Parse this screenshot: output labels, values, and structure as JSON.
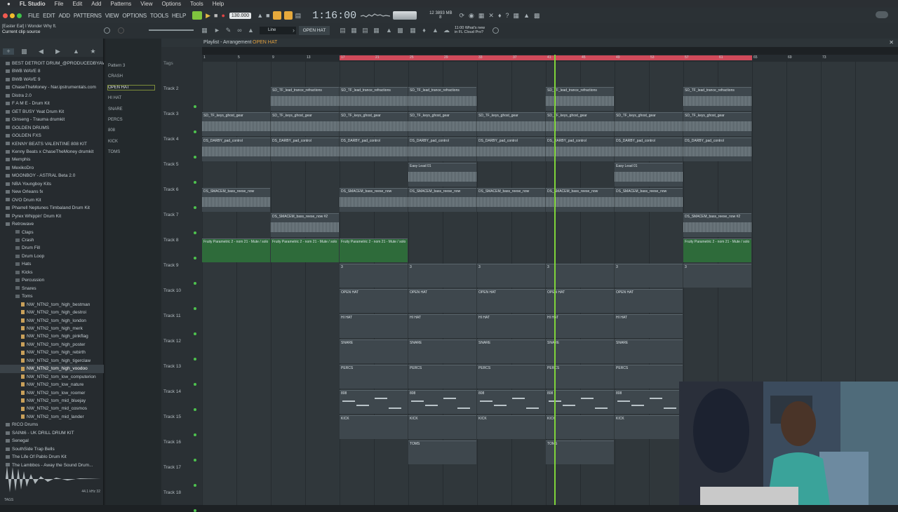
{
  "menubar": {
    "app": "FL Studio",
    "items": [
      "File",
      "Edit",
      "Add",
      "Patterns",
      "View",
      "Options",
      "Tools",
      "Help"
    ]
  },
  "toolbar": {
    "menu": [
      "FILE",
      "EDIT",
      "ADD",
      "PATTERNS",
      "VIEW",
      "OPTIONS",
      "TOOLS",
      "HELP"
    ],
    "tempo": "130.000",
    "time": "1:16:00",
    "pattern_label": "OPEN HAT",
    "cpu": "12",
    "memory": "3893 MB",
    "mem_voices": "8",
    "snap": "Line",
    "news_line1": "11:00 What's new",
    "news_line2": "in FL Cloud Pro?"
  },
  "hint": {
    "line1": "[Easter Eat] I Wonder Why ft.",
    "line2": "Current clip source"
  },
  "playlist": {
    "title": "Playlist - Arrangement",
    "pattern": "OPEN HAT",
    "tags_label": "Tags"
  },
  "browser": {
    "items": [
      {
        "label": "BEST DETROIT DRUM_@PRODUCEDBYAVEN",
        "type": "folder"
      },
      {
        "label": "BWB WAVE 8",
        "type": "folder"
      },
      {
        "label": "BWB WAVE 9",
        "type": "folder"
      },
      {
        "label": "ChaseTheMoney - Nar.ipstrumentals.com",
        "type": "folder"
      },
      {
        "label": "Distra 2.0",
        "type": "folder"
      },
      {
        "label": "F A M E - Drum Kit",
        "type": "folder"
      },
      {
        "label": "GET BUSY Yeat Drum Kit",
        "type": "folder"
      },
      {
        "label": "Ginseng - Trauma drumkit",
        "type": "folder"
      },
      {
        "label": "GOLDEN DRUMS",
        "type": "folder"
      },
      {
        "label": "GOLDEN FXS",
        "type": "folder"
      },
      {
        "label": "KENNY BEATS VALENTINE 808 KIT",
        "type": "folder"
      },
      {
        "label": "Kenny Beats x ChaseTheMoney drumkit",
        "type": "folder"
      },
      {
        "label": "Memphis",
        "type": "folder"
      },
      {
        "label": "MexikoDro",
        "type": "folder"
      },
      {
        "label": "MOONBOY - ASTRAL Beta 2.0",
        "type": "folder"
      },
      {
        "label": "NBA Youngboy Kits",
        "type": "folder"
      },
      {
        "label": "New Orleans fx",
        "type": "folder"
      },
      {
        "label": "OVO Drum Kit",
        "type": "folder"
      },
      {
        "label": "Pharrell Neptunes Timbaland Drum Kit",
        "type": "folder"
      },
      {
        "label": "Pyrex Whippin' Drum Kit",
        "type": "folder"
      },
      {
        "label": "Retrowave",
        "type": "folder"
      },
      {
        "label": "Claps",
        "type": "sub"
      },
      {
        "label": "Crash",
        "type": "sub"
      },
      {
        "label": "Drum Fill",
        "type": "sub"
      },
      {
        "label": "Drum Loop",
        "type": "sub"
      },
      {
        "label": "Hats",
        "type": "sub"
      },
      {
        "label": "Kicks",
        "type": "sub"
      },
      {
        "label": "Percussion",
        "type": "sub"
      },
      {
        "label": "Snares",
        "type": "sub"
      },
      {
        "label": "Toms",
        "type": "sub"
      },
      {
        "label": "NW_NTN2_tom_high_bestman",
        "type": "file"
      },
      {
        "label": "NW_NTN2_tom_high_destroi",
        "type": "file"
      },
      {
        "label": "NW_NTN2_tom_high_london",
        "type": "file"
      },
      {
        "label": "NW_NTN2_tom_high_merk",
        "type": "file"
      },
      {
        "label": "NW_NTN2_tom_high_pinkflag",
        "type": "file"
      },
      {
        "label": "NW_NTN2_tom_high_poster",
        "type": "file"
      },
      {
        "label": "NW_NTN2_tom_high_rebirth",
        "type": "file"
      },
      {
        "label": "NW_NTN2_tom_high_tigerclaw",
        "type": "file"
      },
      {
        "label": "NW_NTN2_tom_high_voodoo",
        "type": "file",
        "selected": true
      },
      {
        "label": "NW_NTN2_tom_low_computerion",
        "type": "file"
      },
      {
        "label": "NW_NTN2_tom_low_nature",
        "type": "file"
      },
      {
        "label": "NW_NTN2_tom_low_roomer",
        "type": "file"
      },
      {
        "label": "NW_NTN2_tom_mid_bluejay",
        "type": "file"
      },
      {
        "label": "NW_NTN2_tom_mid_cosmos",
        "type": "file"
      },
      {
        "label": "NW_NTN2_tom_mid_lander",
        "type": "file"
      },
      {
        "label": "RICO Drums",
        "type": "folder"
      },
      {
        "label": "SAINt6 - UK DRILL DRUM KIT",
        "type": "folder"
      },
      {
        "label": "Senegal",
        "type": "folder"
      },
      {
        "label": "SouthSide Trap Bells",
        "type": "folder"
      },
      {
        "label": "The Life Of Pablo Drum Kit",
        "type": "folder"
      },
      {
        "label": "The Lambbos - Away the Sound Drum...",
        "type": "folder"
      }
    ],
    "sample_info": "44.1 kHz 32",
    "tags_label": "TAGS"
  },
  "patterns": [
    "Pattern 3",
    "CRASH",
    "OPEN HAT",
    "HI HAT",
    "SNARE",
    "PERCS",
    "808",
    "KICK",
    "TOMS"
  ],
  "tracks": [
    "Track 2",
    "Track 3",
    "Track 4",
    "Track 5",
    "Track 6",
    "Track 7",
    "Track 8",
    "Track 9",
    "Track 10",
    "Track 11",
    "Track 12",
    "Track 13",
    "Track 14",
    "Track 15",
    "Track 16",
    "Track 17",
    "Track 18"
  ],
  "ruler": [
    "1",
    "5",
    "9",
    "13",
    "17",
    "21",
    "25",
    "29",
    "33",
    "37",
    "41",
    "45",
    "49",
    "53",
    "57",
    "61",
    "65",
    "69",
    "73"
  ],
  "clip_names": {
    "lead": "SD_TF_lead_trance_refractions",
    "keys": "SD_TF_keys_ghost_gear",
    "pad": "DS_DARBY_pad_control",
    "easy": "Easy Lead 01",
    "bass": "DS_SMACEM_bass_reese_now",
    "bass2": "DS_SMACEM_bass_reese_now #2",
    "fruity": "Fruity Parametric 2 - nom 21 - Mute / solo",
    "nine": "3",
    "openhat": "OPEN HAT",
    "hihat": "HI HAT",
    "snare": "SNARE",
    "percs": "PERCS",
    "bass808": "808",
    "kick": "KICK",
    "toms": "TOMS"
  },
  "colors": {
    "accent": "#4ec34e",
    "playhead": "#7fd43a",
    "loop": "#d04a5a",
    "clip": "#3e474d"
  }
}
